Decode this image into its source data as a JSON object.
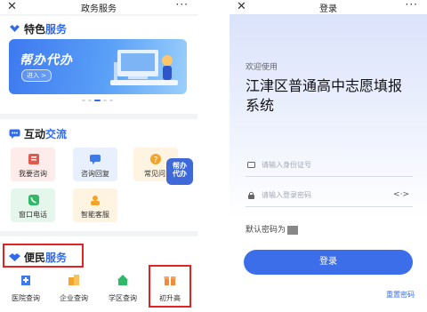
{
  "left": {
    "topbar": {
      "close": "✕",
      "title": "政务服务",
      "more": "···"
    },
    "special": {
      "title_a": "特色",
      "title_b": "服务",
      "banner_title": "帮办代办",
      "banner_btn": "进入 >"
    },
    "interact": {
      "title_a": "互动",
      "title_b": "交流",
      "items": [
        {
          "label": "我要咨询",
          "icon": "inquiry-icon",
          "bg": "#fdecea",
          "color": "#e05a4f"
        },
        {
          "label": "咨询回复",
          "icon": "reply-icon",
          "bg": "#e8f0fd",
          "color": "#3f7be8"
        },
        {
          "label": "常见问",
          "icon": "faq-icon",
          "bg": "#fff4e1",
          "color": "#f3a52b"
        },
        {
          "label": "窗口电话",
          "icon": "phone-icon",
          "bg": "#e5f7ec",
          "color": "#2eb868"
        },
        {
          "label": "智能客服",
          "icon": "robot-icon",
          "bg": "#fff4e1",
          "color": "#f3a52b"
        }
      ],
      "float_btn": "帮办\n代办"
    },
    "convenience": {
      "title_a": "便民",
      "title_b": "服务",
      "items": [
        {
          "label": "医院查询",
          "icon": "hospital-icon",
          "color": "#3f7be8"
        },
        {
          "label": "企业查询",
          "icon": "enterprise-icon",
          "color": "#f3a52b"
        },
        {
          "label": "学区查询",
          "icon": "school-district-icon",
          "color": "#2eb868"
        },
        {
          "label": "初升高",
          "icon": "gift-box-icon",
          "color": "#f08b3a"
        }
      ]
    }
  },
  "right": {
    "topbar": {
      "close": "✕",
      "title": "登录",
      "more": "···"
    },
    "welcome": "欢迎使用",
    "system_title": "江津区普通高中志愿填报系统",
    "id_placeholder": "请输入身份证号",
    "pw_placeholder": "请输入登录密码",
    "default_pw_label": "默认密码为",
    "login_btn": "登录",
    "reset_pw": "重置密码"
  },
  "colors": {
    "accent": "#2f6bf0",
    "highlight_box": "#e02424",
    "login_btn": "#3b6ee8"
  }
}
